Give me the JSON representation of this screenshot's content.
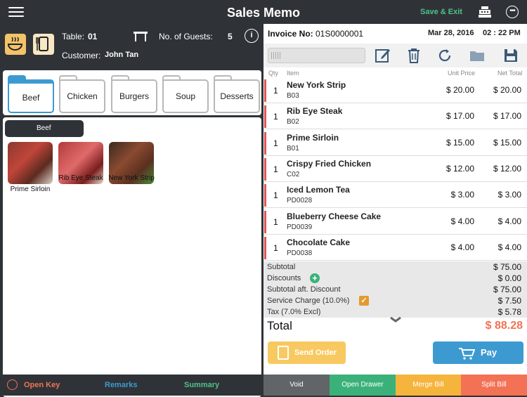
{
  "header": {
    "title": "Sales Memo",
    "save_exit": "Save & Exit"
  },
  "left": {
    "table_label": "Table:",
    "table_value": "01",
    "guests_label": "No. of Guests:",
    "guests_value": "5",
    "customer_label": "Customer:",
    "customer_value": "John Tan",
    "categories": [
      "Beef",
      "Chicken",
      "Burgers",
      "Soup",
      "Desserts"
    ],
    "selected_category": "Beef",
    "products": [
      "Prime Sirloin",
      "Rib Eye Steak",
      "New York Strip"
    ],
    "bottom": {
      "open_key": "Open Key",
      "remarks": "Remarks",
      "summary": "Summary"
    }
  },
  "invoice": {
    "label": "Invoice No:",
    "number": "01S0000001",
    "date": "Mar 28, 2016",
    "time": "02 : 22 PM",
    "columns": {
      "qty": "Qty",
      "item": "Item",
      "unit_price": "Unit Price",
      "net_total": "Net Total"
    },
    "rows": [
      {
        "qty": "1",
        "name": "New York Strip",
        "code": "B03",
        "unit": "$ 20.00",
        "net": "$ 20.00"
      },
      {
        "qty": "1",
        "name": "Rib Eye Steak",
        "code": "B02",
        "unit": "$ 17.00",
        "net": "$ 17.00"
      },
      {
        "qty": "1",
        "name": "Prime Sirloin",
        "code": "B01",
        "unit": "$ 15.00",
        "net": "$ 15.00"
      },
      {
        "qty": "1",
        "name": "Crispy Fried Chicken",
        "code": "C02",
        "unit": "$ 12.00",
        "net": "$ 12.00"
      },
      {
        "qty": "1",
        "name": "Iced Lemon Tea",
        "code": "PD0028",
        "unit": "$ 3.00",
        "net": "$ 3.00"
      },
      {
        "qty": "1",
        "name": "Blueberry Cheese Cake",
        "code": "PD0039",
        "unit": "$ 4.00",
        "net": "$ 4.00"
      },
      {
        "qty": "1",
        "name": "Chocolate Cake",
        "code": "PD0038",
        "unit": "$ 4.00",
        "net": "$ 4.00"
      }
    ],
    "totals": {
      "subtotal_label": "Subtotal",
      "subtotal": "$ 75.00",
      "discounts_label": "Discounts",
      "discounts": "$ 0.00",
      "after_label": "Subtotal aft. Discount",
      "after": "$ 75.00",
      "service_label": "Service Charge (10.0%)",
      "service": "$ 7.50",
      "tax_label": "Tax (7.0% Excl)",
      "tax": "$ 5.78",
      "total_label": "Total",
      "total": "$ 88.28"
    },
    "send_order": "Send Order",
    "pay": "Pay",
    "actions": [
      "Void",
      "Open Drawer",
      "Merge Bill",
      "Split Bill"
    ]
  },
  "colors": {
    "accent_blue": "#3d9ad1",
    "accent_orange": "#f37256",
    "accent_green": "#4cc38a",
    "send_yellow": "#f8c960",
    "dark": "#2f3337"
  }
}
